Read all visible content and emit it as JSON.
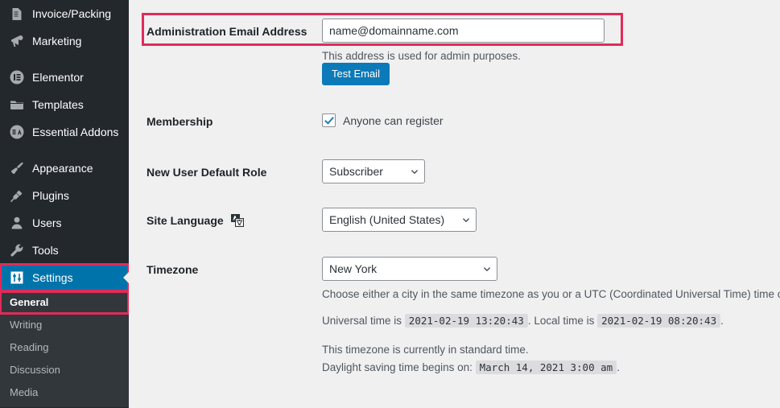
{
  "sidebar": {
    "items": [
      {
        "label": "Invoice/Packing",
        "icon": "document-icon"
      },
      {
        "label": "Marketing",
        "icon": "megaphone-icon"
      },
      {
        "label": "Elementor",
        "icon": "elementor-icon"
      },
      {
        "label": "Templates",
        "icon": "folder-icon"
      },
      {
        "label": "Essential Addons",
        "icon": "essential-addons-icon"
      },
      {
        "label": "Appearance",
        "icon": "paintbrush-icon"
      },
      {
        "label": "Plugins",
        "icon": "plug-icon"
      },
      {
        "label": "Users",
        "icon": "user-icon"
      },
      {
        "label": "Tools",
        "icon": "wrench-icon"
      },
      {
        "label": "Settings",
        "icon": "settings-sliders-icon"
      }
    ],
    "current_item": "Settings",
    "submenu": [
      {
        "label": "General",
        "active": true
      },
      {
        "label": "Writing",
        "active": false
      },
      {
        "label": "Reading",
        "active": false
      },
      {
        "label": "Discussion",
        "active": false
      },
      {
        "label": "Media",
        "active": false
      }
    ],
    "highlight_color": "#e02b5a",
    "active_color": "#0073aa"
  },
  "settings": {
    "admin_email": {
      "label": "Administration Email Address",
      "value": "name@domainname.com",
      "placeholder": "name@domainname.com",
      "description": "This address is used for admin purposes.",
      "test_email_button": "Test Email"
    },
    "membership": {
      "label": "Membership",
      "checkbox_label": "Anyone can register",
      "checked": true
    },
    "default_role": {
      "label": "New User Default Role",
      "value": "Subscriber"
    },
    "site_language": {
      "label": "Site Language",
      "icon": "translation-icon",
      "value": "English (United States)"
    },
    "timezone": {
      "label": "Timezone",
      "value": "New York",
      "description": "Choose either a city in the same timezone as you or a UTC (Coordinated Universal Time) time offset.",
      "universal_time_prefix": "Universal time is",
      "universal_time": "2021-02-19 13:20:43",
      "universal_time_sep": ".",
      "local_time_prefix": "Local time is",
      "local_time": "2021-02-19 08:20:43",
      "local_time_sep": ".",
      "standard_time_note": "This timezone is currently in standard time.",
      "dst_prefix": "Daylight saving time begins on:",
      "dst_date": "March 14, 2021 3:00 am",
      "dst_sep": "."
    }
  }
}
